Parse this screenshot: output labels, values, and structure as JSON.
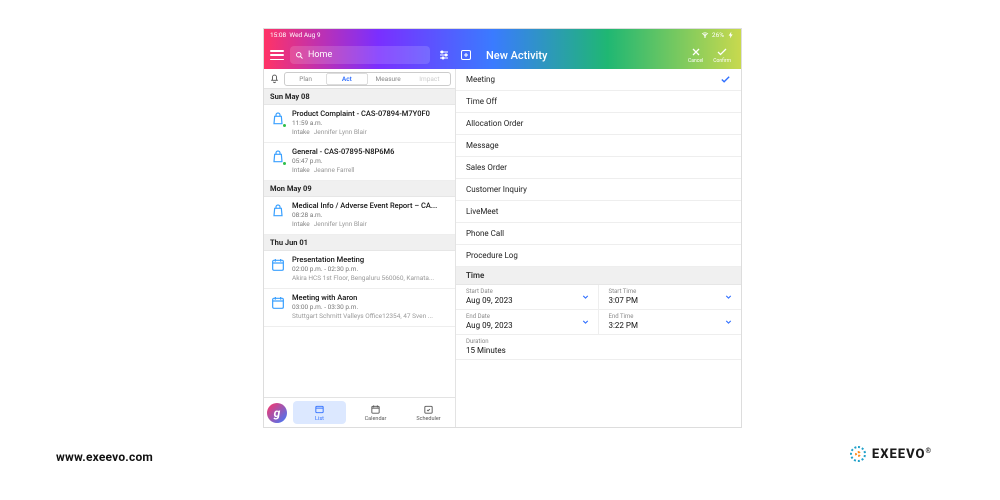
{
  "status": {
    "time": "15:08",
    "date": "Wed Aug 9",
    "battery": "26%"
  },
  "header_left": {
    "search_text": "Home"
  },
  "header_right": {
    "title": "New Activity",
    "cancel": "Cancel",
    "confirm": "Confirm"
  },
  "tabs": {
    "plan": "Plan",
    "act": "Act",
    "measure": "Measure",
    "impact": "Impact"
  },
  "sections": [
    {
      "header": "Sun May 08",
      "items": [
        {
          "title": "Product Complaint - CAS-07894-M7Y0F0",
          "time": "11:59 a.m.",
          "tag": "Intake",
          "person": "Jennifer Lynn Blair",
          "icon": "case",
          "dot": true
        },
        {
          "title": "General - CAS-07895-N8P6M6",
          "time": "05:47 p.m.",
          "tag": "Intake",
          "person": "Jeanne Farrell",
          "icon": "case",
          "dot": true
        }
      ]
    },
    {
      "header": "Mon May 09",
      "items": [
        {
          "title": "Medical Info / Adverse Event Report – CA...",
          "time": "08:28 a.m.",
          "tag": "Intake",
          "person": "Jennifer Lynn Blair",
          "icon": "case",
          "dot": false
        }
      ]
    },
    {
      "header": "Thu Jun 01",
      "items": [
        {
          "title": "Presentation Meeting",
          "time": "02:00 p.m. - 02:30 p.m.",
          "tag": "",
          "person": "Akira HCS 1st Floor, Bengaluru 560060, Karnata...",
          "icon": "calendar",
          "dot": false
        },
        {
          "title": "Meeting with Aaron",
          "time": "03:00 p.m. - 03:30 p.m.",
          "tag": "",
          "person": "Stuttgart Schmitt Valleys Office12354, 47 Sven ...",
          "icon": "calendar",
          "dot": false
        }
      ]
    }
  ],
  "bottomnav": {
    "list": "List",
    "calendar": "Calendar",
    "scheduler": "Scheduler"
  },
  "options": [
    "Meeting",
    "Time Off",
    "Allocation Order",
    "Message",
    "Sales Order",
    "Customer Inquiry",
    "LiveMeet",
    "Phone Call",
    "Procedure Log"
  ],
  "option_selected_index": 0,
  "time_section": {
    "title": "Time",
    "start_date_label": "Start Date",
    "start_date": "Aug 09, 2023",
    "start_time_label": "Start Time",
    "start_time": "3:07 PM",
    "end_date_label": "End Date",
    "end_date": "Aug 09, 2023",
    "end_time_label": "End Time",
    "end_time": "3:22 PM",
    "duration_label": "Duration",
    "duration": "15 Minutes"
  },
  "footer": {
    "url": "www.exeevo.com",
    "brand": "EXEEVO"
  }
}
